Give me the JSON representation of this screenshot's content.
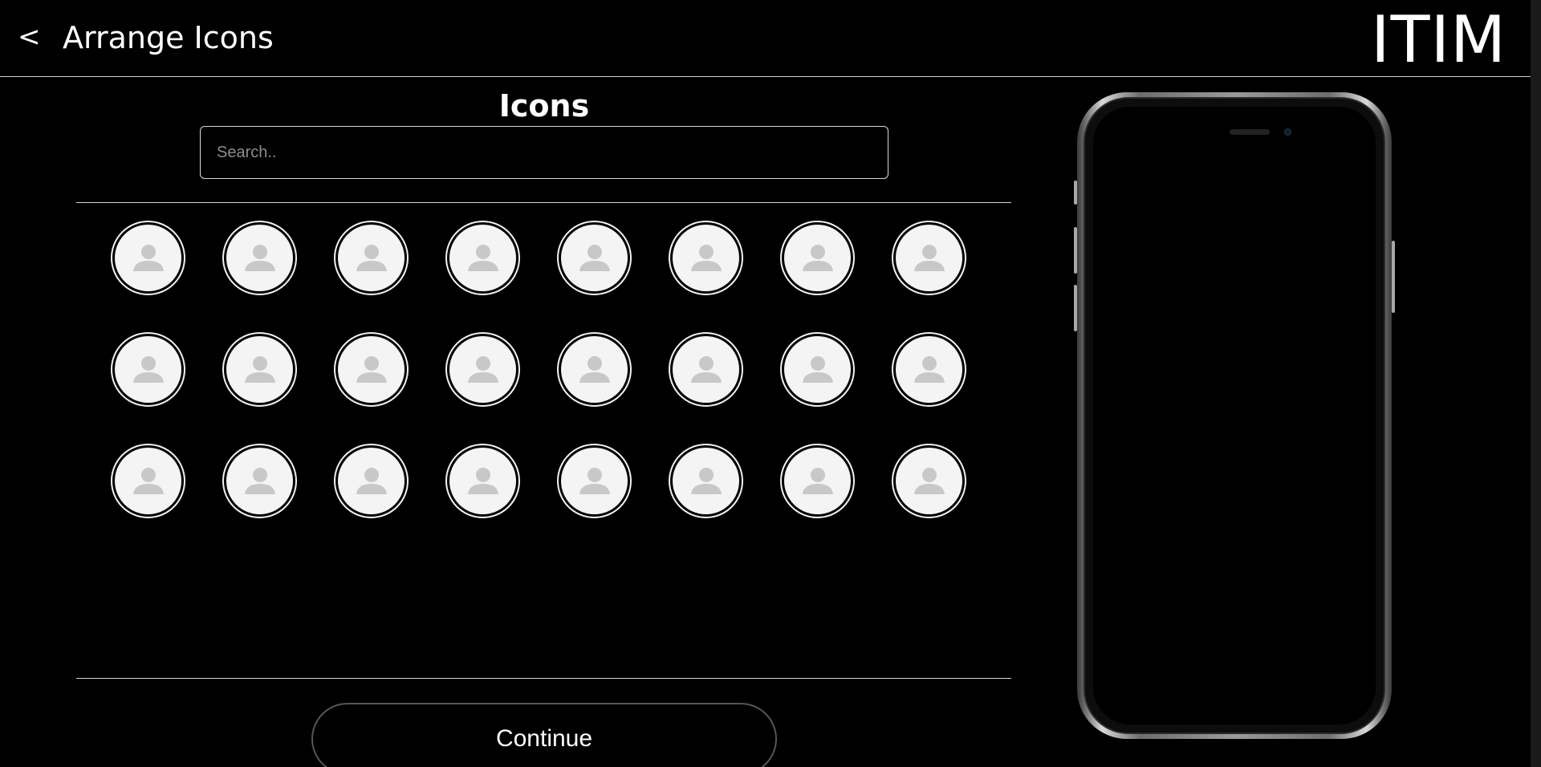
{
  "header": {
    "back_label": "<",
    "title": "Arrange Icons",
    "logo_text": "ITIM"
  },
  "icons_panel": {
    "title": "Icons",
    "search_placeholder": "Search..",
    "search_value": "",
    "rows": 3,
    "columns": 8,
    "tile_icon": "user-avatar-placeholder-icon"
  },
  "actions": {
    "continue_label": "Continue"
  },
  "phone_preview": {
    "device": "smartphone-mockup"
  },
  "colors": {
    "background": "#000000",
    "foreground": "#ffffff",
    "tile_fill": "#f4f4f4",
    "avatar_gray": "#c8c8c8"
  }
}
